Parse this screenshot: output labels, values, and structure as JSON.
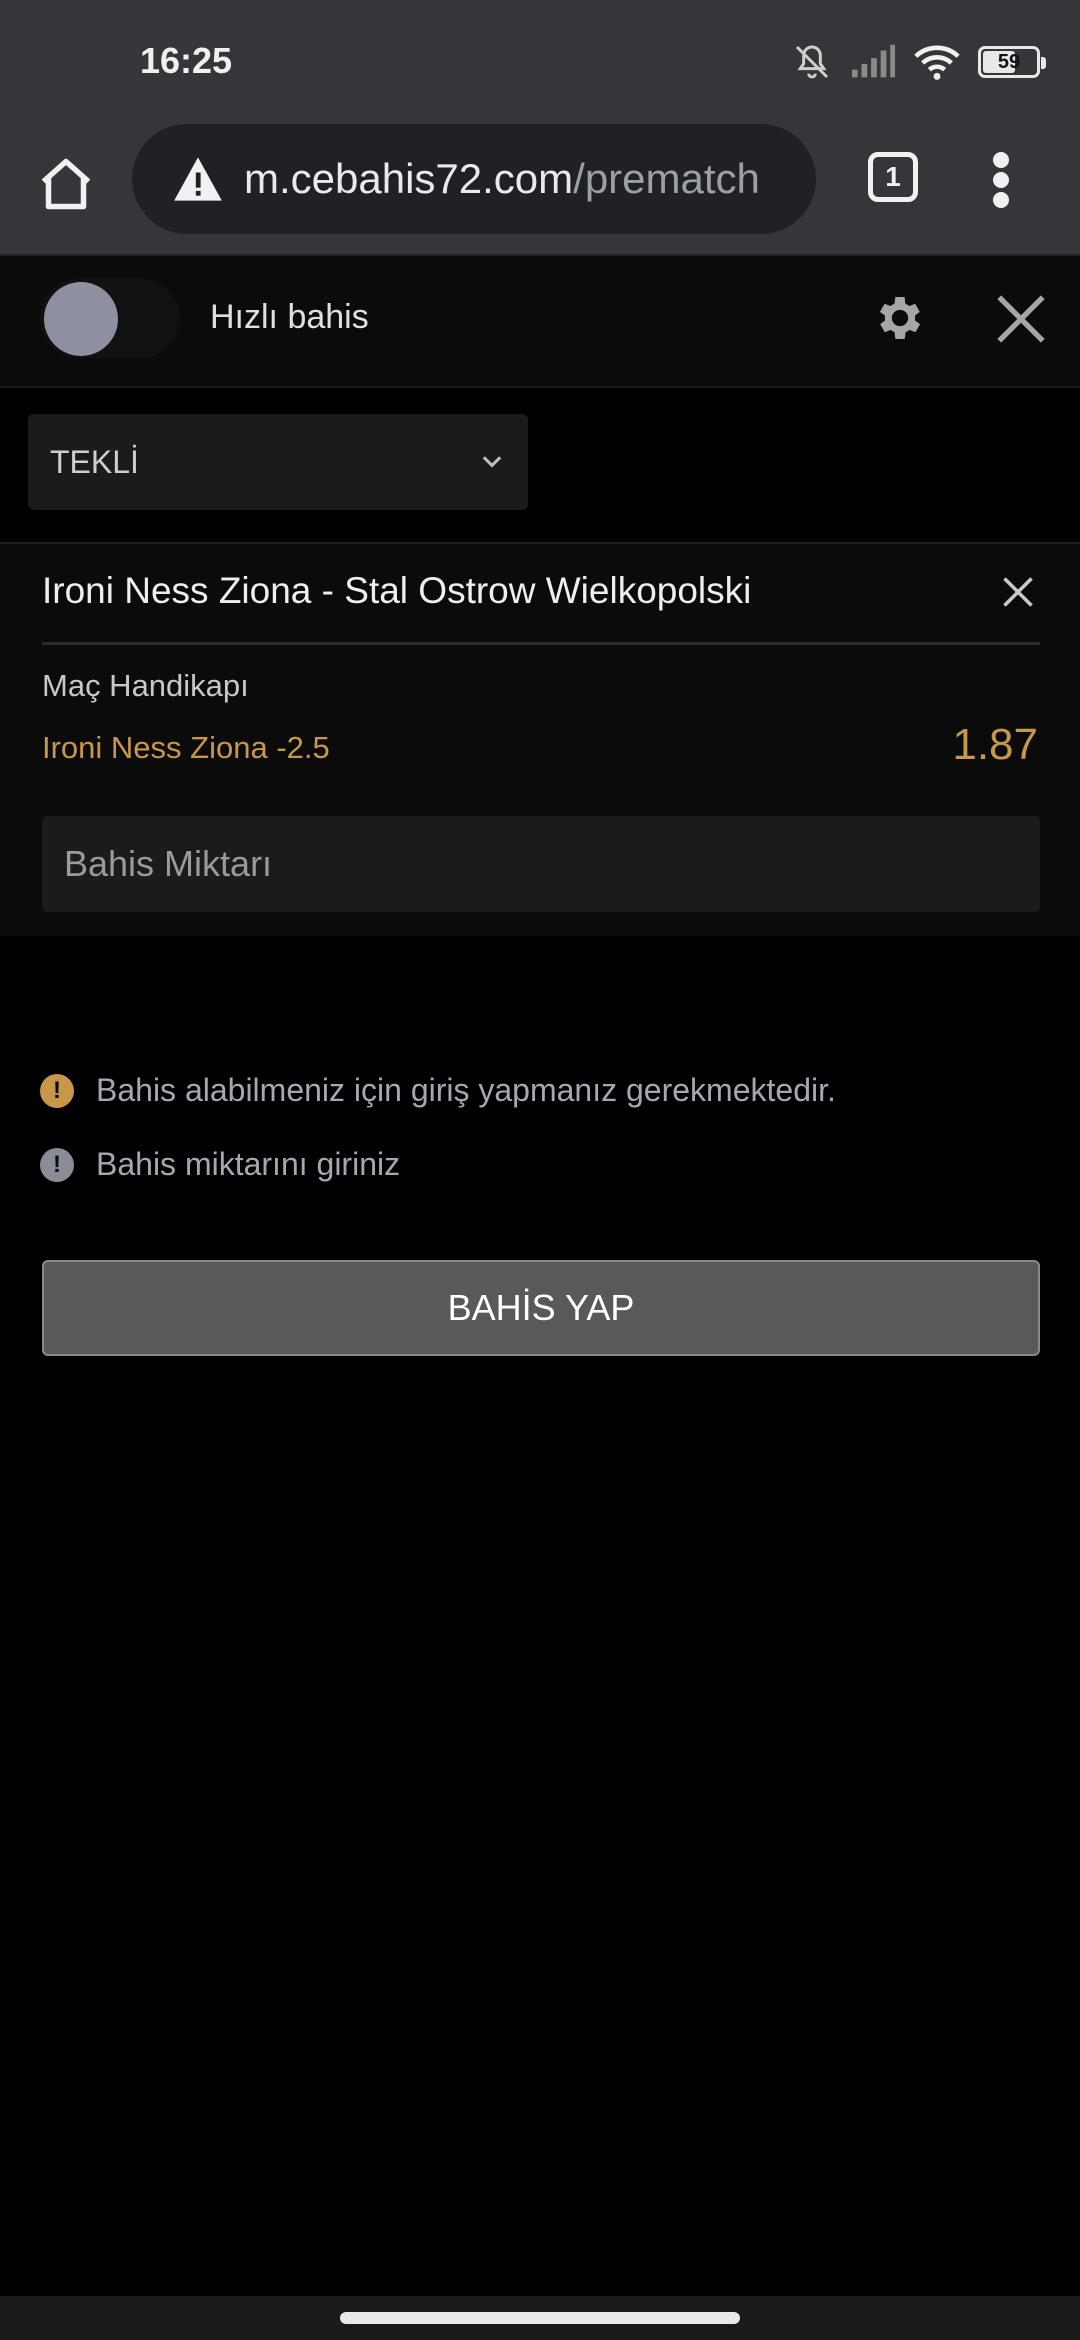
{
  "status_bar": {
    "time": "16:25",
    "battery": "59",
    "icons": [
      "bell-off-icon",
      "signal-icon",
      "wifi-icon",
      "battery-icon"
    ]
  },
  "browser": {
    "url_host": "m.cebahis72.com",
    "url_path": "/prematch",
    "tab_count": "1",
    "icons": [
      "home-icon",
      "warning-icon",
      "tabs-icon",
      "more-vert-icon"
    ]
  },
  "quick_bet": {
    "label": "Hızlı bahis",
    "icons": [
      "gear-icon",
      "close-icon"
    ]
  },
  "bet_type": {
    "selected": "TEKLİ"
  },
  "bet": {
    "match": "Ironi Ness Ziona - Stal Ostrow Wielkopolski",
    "market": "Maç Handikapı",
    "selection": "Ironi Ness Ziona -2.5",
    "odds": "1.87",
    "stake_placeholder": "Bahis Miktarı"
  },
  "messages": [
    {
      "text": "Bahis alabilmeniz için giriş yapmanız gerekmektedir.",
      "icon": "exclamation-icon",
      "color": "#c7974a"
    },
    {
      "text": "Bahis miktarını giriniz",
      "icon": "exclamation-icon",
      "color": "#8a8d96"
    }
  ],
  "place_bet_label": "BAHİS YAP"
}
